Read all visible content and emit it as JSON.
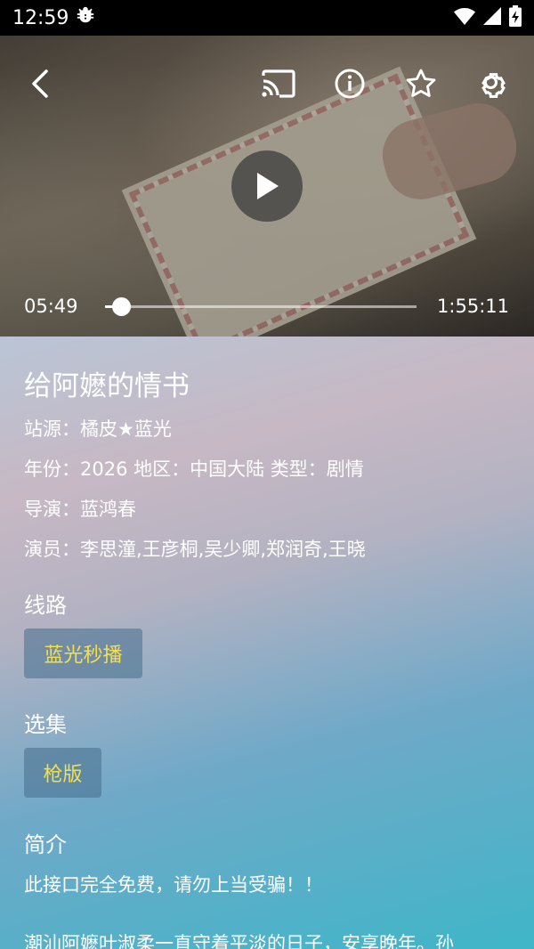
{
  "status_bar": {
    "time": "12:59",
    "bug_icon": "bug-icon",
    "wifi_icon": "wifi-icon",
    "signal_icon": "signal-icon",
    "battery_icon": "battery-charging-icon"
  },
  "player": {
    "current_time": "05:49",
    "total_time": "1:55:11",
    "progress": 0.05,
    "icons": [
      "back-icon",
      "cast-icon",
      "info-icon",
      "star-icon",
      "settings-icon",
      "play-icon"
    ]
  },
  "detail": {
    "title": "给阿嬷的情书",
    "source": "站源：橘皮★蓝光",
    "year_region_type": "年份：2026  地区：中国大陆  类型：剧情",
    "director": "导演：蓝鸿春",
    "cast": "演员：李思潼,王彦桐,吴少卿,郑润奇,王晓"
  },
  "route": {
    "heading": "线路",
    "selected": "蓝光秒播"
  },
  "episodes": {
    "heading": "选集",
    "selected": "枪版"
  },
  "intro": {
    "heading": "简介",
    "notice": "此接口完全免费，请勿上当受骗！！",
    "summary": "潮汕阿嬷叶淑柔一直守着平淡的日子，安享晚年。孙"
  },
  "colors": {
    "chip_text": "#f5e04a",
    "chip_bg": "#466e8c"
  }
}
